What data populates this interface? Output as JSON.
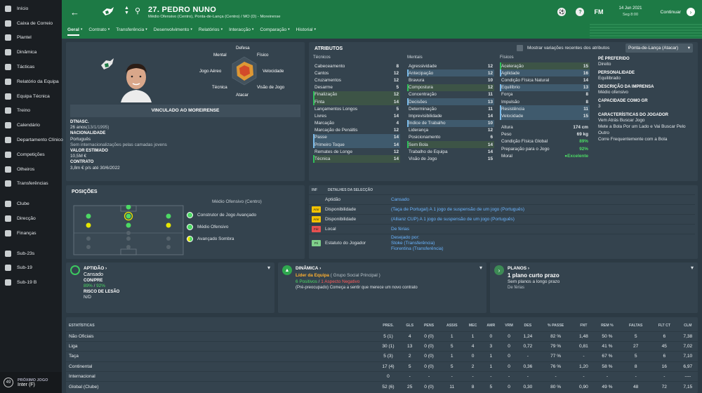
{
  "sidebar": {
    "items": [
      {
        "label": "Início"
      },
      {
        "label": "Caixa de Correio"
      },
      {
        "label": "Plantel"
      },
      {
        "label": "Dinâmica"
      },
      {
        "label": "Tácticas"
      },
      {
        "label": "Relatório da Equipa"
      },
      {
        "label": "Equipa Técnica"
      },
      {
        "label": "Treino"
      },
      {
        "label": "Calendário"
      },
      {
        "label": "Departamento Clínico"
      },
      {
        "label": "Competições"
      },
      {
        "label": "Olheiros"
      },
      {
        "label": "Transferências"
      },
      {
        "label": "Clube"
      },
      {
        "label": "Direcção"
      },
      {
        "label": "Finanças"
      },
      {
        "label": "Sub-23s"
      },
      {
        "label": "Sub-19"
      },
      {
        "label": "Sub-19 B"
      }
    ],
    "next_match": {
      "badge": "49",
      "title": "PRÓXIMO JOGO",
      "opponent": "Inter (F)"
    }
  },
  "header": {
    "player_name": "27. PEDRO NUNO",
    "subtitle": "Médio Ofensivo (Centro), Ponta-de-Lança (Centro) / MO (D) - Moreirense",
    "fm_label": "FM",
    "date": "14 Jun 2021",
    "day_time": "Seg 8:00",
    "continue_label": "Continuar",
    "help_icon": "?",
    "accent": "#1d7a45"
  },
  "tabs": [
    "Geral",
    "Contrato",
    "Transferência",
    "Desenvolvimento",
    "Relatórios",
    "Interacção",
    "Comparação",
    "Historial"
  ],
  "profile": {
    "radar": {
      "top": "Defesa",
      "tl": "Mental",
      "tr": "Físico",
      "l": "Jogo Aéreo",
      "r": "Velocidade",
      "bl": "Técnica",
      "br": "Visão de Jogo",
      "bottom": "Atacar"
    },
    "club_banner": "VINCULADO AO MOREIRENSE",
    "dob_label": "DTNASC.",
    "dob": "26 anos",
    "dob_date": "(13/1/1995)",
    "nat_label": "NACIONALIDADE",
    "nationality": "Português",
    "intl": "Sem internacionalizações pelas camadas jovens",
    "value_label": "VALOR ESTIMADO",
    "value": "10,5M €",
    "contract_label": "CONTRATO",
    "contract": "3,8m € p/s até 30/6/2022"
  },
  "attributes": {
    "title": "ATRIBUTOS",
    "toggle_label": "Mostrar variações recentes dos atributos",
    "role_select": "Ponta-de-Lança (Atacar)",
    "headers": {
      "technical": "Técnicos",
      "mental": "Mentais",
      "physical": "Físicos"
    },
    "technical": [
      {
        "name": "Cabeceamento",
        "value": "8",
        "hl": ""
      },
      {
        "name": "Cantos",
        "value": "12",
        "hl": ""
      },
      {
        "name": "Cruzamentos",
        "value": "12",
        "hl": ""
      },
      {
        "name": "Desarme",
        "value": "5",
        "hl": ""
      },
      {
        "name": "Finalização",
        "value": "12",
        "hl": "g"
      },
      {
        "name": "Finta",
        "value": "14",
        "hl": "g"
      },
      {
        "name": "Lançamentos Longos",
        "value": "5",
        "hl": ""
      },
      {
        "name": "Livres",
        "value": "14",
        "hl": ""
      },
      {
        "name": "Marcação",
        "value": "4",
        "hl": ""
      },
      {
        "name": "Marcação de Penáltis",
        "value": "12",
        "hl": ""
      },
      {
        "name": "Passe",
        "value": "14",
        "hl": "b"
      },
      {
        "name": "Primeiro Toque",
        "value": "14",
        "hl": "b"
      },
      {
        "name": "Remates de Longe",
        "value": "12",
        "hl": ""
      },
      {
        "name": "Técnica",
        "value": "14",
        "hl": "g"
      }
    ],
    "mental": [
      {
        "name": "Agressividade",
        "value": "12",
        "hl": ""
      },
      {
        "name": "Antecipação",
        "value": "12",
        "hl": "b"
      },
      {
        "name": "Bravura",
        "value": "10",
        "hl": ""
      },
      {
        "name": "Compostura",
        "value": "12",
        "hl": "g"
      },
      {
        "name": "Concentração",
        "value": "11",
        "hl": ""
      },
      {
        "name": "Decisões",
        "value": "13",
        "hl": "b"
      },
      {
        "name": "Determinação",
        "value": "11",
        "hl": ""
      },
      {
        "name": "Imprevisibilidade",
        "value": "14",
        "hl": ""
      },
      {
        "name": "Índice de Trabalho",
        "value": "10",
        "hl": "b"
      },
      {
        "name": "Liderança",
        "value": "12",
        "hl": ""
      },
      {
        "name": "Posicionamento",
        "value": "6",
        "hl": ""
      },
      {
        "name": "Sem Bola",
        "value": "14",
        "hl": "g"
      },
      {
        "name": "Trabalho de Equipa",
        "value": "14",
        "hl": ""
      },
      {
        "name": "Visão de Jogo",
        "value": "15",
        "hl": ""
      }
    ],
    "physical": [
      {
        "name": "Aceleração",
        "value": "15",
        "hl": "g"
      },
      {
        "name": "Agilidade",
        "value": "16",
        "hl": "b"
      },
      {
        "name": "Condição Física Natural",
        "value": "14",
        "hl": ""
      },
      {
        "name": "Equilíbrio",
        "value": "13",
        "hl": "b"
      },
      {
        "name": "Força",
        "value": "8",
        "hl": ""
      },
      {
        "name": "Impulsão",
        "value": "8",
        "hl": ""
      },
      {
        "name": "Resistência",
        "value": "11",
        "hl": "b"
      },
      {
        "name": "Velocidade",
        "value": "15",
        "hl": "b"
      }
    ],
    "extra": [
      {
        "name": "Altura",
        "value": "174 cm",
        "color": ""
      },
      {
        "name": "Peso",
        "value": "69 kg",
        "color": ""
      },
      {
        "name": "Condição Física Global",
        "value": "89%",
        "color": "green"
      },
      {
        "name": "Preparação para o Jogo",
        "value": "92%",
        "color": "green"
      },
      {
        "name": "Moral",
        "value": "Excelente",
        "color": "green"
      }
    ],
    "right": [
      {
        "label": "PÉ PREFERIDO",
        "lines": [
          "Direito"
        ]
      },
      {
        "label": "PERSONALIDADE",
        "lines": [
          "Equilibrado"
        ]
      },
      {
        "label": "DESCRIÇÃO DA IMPRENSA",
        "lines": [
          "Médio ofensivo"
        ]
      },
      {
        "label": "CAPACIDADE COMO GR",
        "lines": [
          "3"
        ]
      },
      {
        "label": "CARACTERÍSTICAS DO JOGADOR",
        "lines": [
          "Vem Atrás Buscar Jogo",
          "Mete a Bola Por um Lado e Vai Buscar Pelo Outro",
          "Corre Frequentemente com a Bola"
        ]
      }
    ]
  },
  "positions": {
    "title": "POSIÇÕES",
    "main_position": "Médio Ofensivo (Centro)",
    "roles": [
      "Construtor de Jogo Avançado",
      "Médio Ofensivo",
      "Avançado Sombra"
    ]
  },
  "info": {
    "header_inf": "INF",
    "header_det": "DETALHES DA SELECÇÃO",
    "rows": [
      {
        "tag": "",
        "tag_color": "",
        "label": "Aptidão",
        "value": "Cansado"
      },
      {
        "tag": "Amr",
        "tag_color": "#f2c200",
        "label": "Disponibilidade",
        "value": "(Taça de Portugal) A 1 jogo de suspensão de um jogo (Português)"
      },
      {
        "tag": "Amr",
        "tag_color": "#f2c200",
        "label": "Disponibilidade",
        "value": "(Allianz CUP) A 1 jogo de suspensão de um jogo (Português)"
      },
      {
        "tag": "Fér",
        "tag_color": "#e55050",
        "label": "Local",
        "value": "De férias"
      },
      {
        "tag": "Pri",
        "tag_color": "#7fd08b",
        "label": "Estatuto do Jogador",
        "value": "Desejado por:\nStoke (Transferência)\nFiorentina (Transferência)"
      }
    ]
  },
  "cards": {
    "fitness": {
      "title": "APTIDÃO",
      "status": "Cansado",
      "cp_label": "CON/PRE",
      "cp": "89%",
      "cp2": "92%",
      "inj_label": "RISCO DE LESÃO",
      "inj": "N/D"
    },
    "dynamics": {
      "title": "DINÂMICA",
      "role": "Líder da Equipa",
      "group": "( Grupo Social Principal )",
      "positives": "6 Positivos",
      "negative": "1 Aspecto Negativo",
      "note": "(Pré-preocupado) Começa a sentir que merece um novo contrato"
    },
    "plans": {
      "title": "PLANOS",
      "main": "1 plano curto prazo",
      "line1": "Sem planos a longo prazo",
      "line2": "De férias"
    }
  },
  "stats": {
    "headers": [
      "ESTATÍSTICAS",
      "PRES.",
      "GLS",
      "PENS",
      "ASSIS",
      "MEC",
      "AMR",
      "VRM",
      "DES",
      "% PASSE",
      "FNT",
      "REM %",
      "FALTAS",
      "FLT CT",
      "CLM"
    ],
    "rows": [
      [
        "Não Oficiais",
        "5 (1)",
        "4",
        "0 (0)",
        "1",
        "1",
        "0",
        "0",
        "1,24",
        "82 %",
        "1,48",
        "50 %",
        "5",
        "6",
        "7,38"
      ],
      [
        "Liga",
        "30 (1)",
        "13",
        "0 (0)",
        "5",
        "4",
        "3",
        "0",
        "0,72",
        "79 %",
        "0,81",
        "41 %",
        "27",
        "45",
        "7,02"
      ],
      [
        "Taça",
        "5 (3)",
        "2",
        "0 (0)",
        "1",
        "0",
        "1",
        "0",
        "-",
        "77 %",
        "-",
        "67 %",
        "5",
        "6",
        "7,10"
      ],
      [
        "Continental",
        "17 (4)",
        "5",
        "0 (0)",
        "5",
        "2",
        "1",
        "0",
        "0,36",
        "76 %",
        "1,20",
        "58 %",
        "8",
        "16",
        "6,97"
      ],
      [
        "Internacional",
        "0",
        "-",
        "-",
        "-",
        "-",
        "-",
        "-",
        "-",
        "-",
        "-",
        "-",
        "-",
        "-",
        "----"
      ],
      [
        "Global (Clube)",
        "52 (6)",
        "25",
        "0 (0)",
        "11",
        "8",
        "5",
        "0",
        "0,30",
        "80 %",
        "0,90",
        "49 %",
        "48",
        "72",
        "7,15"
      ]
    ]
  }
}
